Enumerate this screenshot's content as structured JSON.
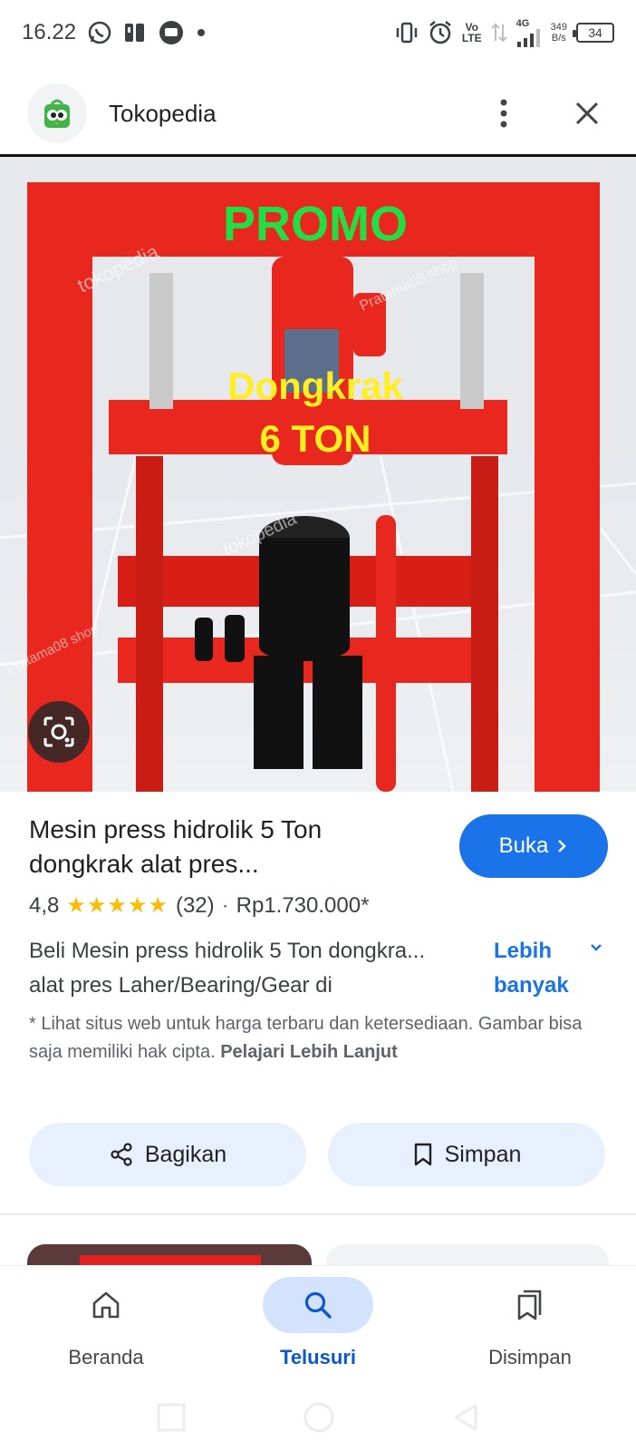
{
  "status_bar": {
    "time": "16.22",
    "volte_top": "Vo",
    "volte_bottom": "LTE",
    "network": "4G",
    "speed_value": "349",
    "speed_unit": "B/s",
    "battery": "34"
  },
  "header": {
    "site_name": "Tokopedia"
  },
  "image": {
    "headline": "PROMO",
    "subline_1": "Dongkrak",
    "subline_2": "6 TON",
    "watermark_1": "tokopedia",
    "watermark_2": "Pratama08 shop"
  },
  "product": {
    "title": "Mesin press hidrolik 5 Ton dongkrak alat pres...",
    "open_button": "Buka",
    "rating": "4,8",
    "stars": "★★★★★",
    "reviews": "(32)",
    "separator": "·",
    "price": "Rp1.730.000*",
    "desc_line_1": "Beli Mesin press hidrolik 5 Ton dongkra...",
    "desc_line_2": "alat pres Laher/Bearing/Gear di",
    "more_label": "Lebih banyak",
    "disclaimer": "* Lihat situs web untuk harga terbaru dan ketersediaan. Gambar bisa saja memiliki hak cipta.",
    "learn_more": "Pelajari Lebih Lanjut"
  },
  "actions": {
    "share": "Bagikan",
    "save": "Simpan"
  },
  "bottom_nav": {
    "home": "Beranda",
    "search": "Telusuri",
    "saved": "Disimpan"
  },
  "colors": {
    "accent": "#1a73e8",
    "active_nav_bg": "#d3e3fd",
    "frame_red": "#e8281e",
    "promo_green": "#22dd44",
    "promo_yellow": "#ffee22"
  }
}
